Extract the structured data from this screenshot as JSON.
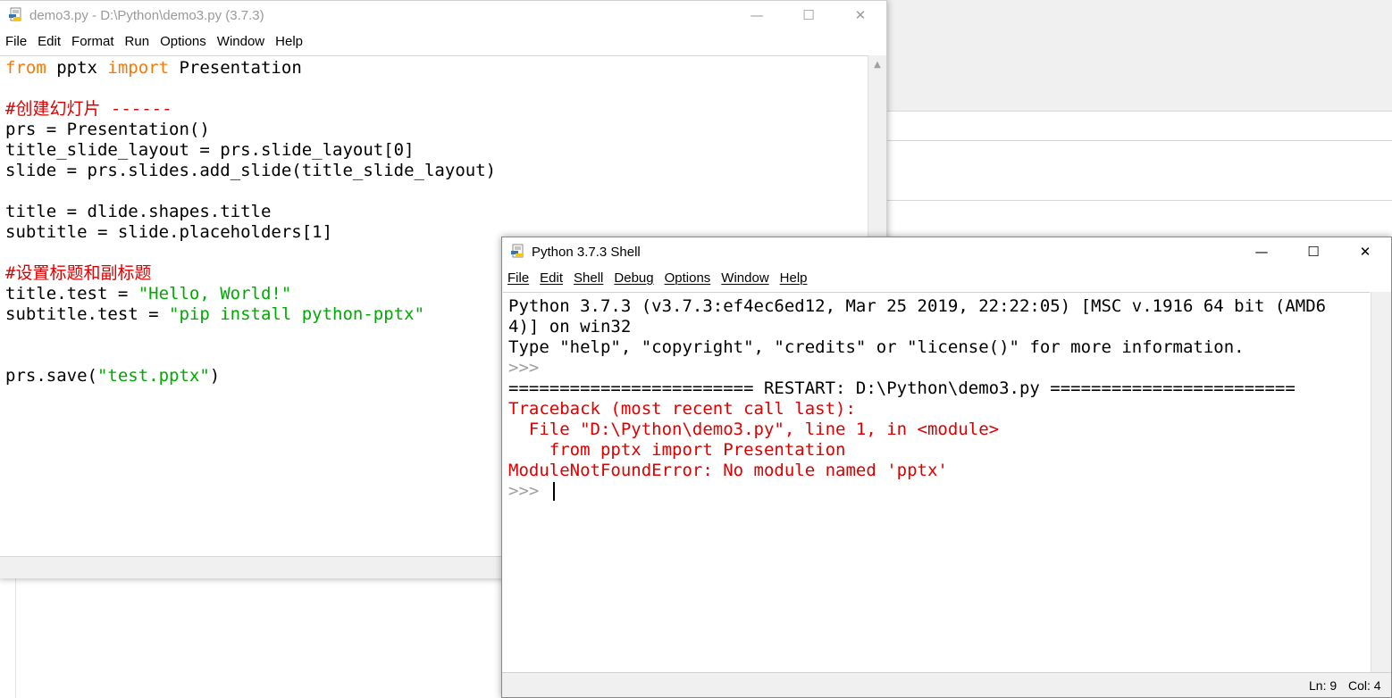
{
  "editor": {
    "title": "demo3.py - D:\\Python\\demo3.py (3.7.3)",
    "menu": [
      "File",
      "Edit",
      "Format",
      "Run",
      "Options",
      "Window",
      "Help"
    ],
    "controls": {
      "minimize": "—",
      "maximize": "☐",
      "close": "✕"
    },
    "code": [
      [
        {
          "t": "from",
          "c": "kw"
        },
        {
          "t": " pptx ",
          "c": ""
        },
        {
          "t": "import",
          "c": "kw"
        },
        {
          "t": " Presentation",
          "c": ""
        }
      ],
      [],
      [
        {
          "t": "#创建幻灯片 ------",
          "c": "cm"
        }
      ],
      [
        {
          "t": "prs = Presentation()",
          "c": ""
        }
      ],
      [
        {
          "t": "title_slide_layout = prs.slide_layout[0]",
          "c": ""
        }
      ],
      [
        {
          "t": "slide = prs.slides.add_slide(title_slide_layout)",
          "c": ""
        }
      ],
      [],
      [
        {
          "t": "title = dlide.shapes.title",
          "c": ""
        }
      ],
      [
        {
          "t": "subtitle = slide.placeholders[1]",
          "c": ""
        }
      ],
      [],
      [
        {
          "t": "#设置标题和副标题",
          "c": "cm"
        }
      ],
      [
        {
          "t": "title.test = ",
          "c": ""
        },
        {
          "t": "\"Hello, World!\"",
          "c": "str"
        }
      ],
      [
        {
          "t": "subtitle.test = ",
          "c": ""
        },
        {
          "t": "\"pip install python-pptx\"",
          "c": "str"
        }
      ],
      [],
      [],
      [
        {
          "t": "prs.save(",
          "c": ""
        },
        {
          "t": "\"test.pptx\"",
          "c": "str"
        },
        {
          "t": ")",
          "c": ""
        }
      ]
    ]
  },
  "shell": {
    "title": "Python 3.7.3 Shell",
    "menu": [
      "File",
      "Edit",
      "Shell",
      "Debug",
      "Options",
      "Window",
      "Help"
    ],
    "controls": {
      "minimize": "—",
      "maximize": "☐",
      "close": "✕"
    },
    "lines": [
      [
        {
          "t": "Python 3.7.3 (v3.7.3:ef4ec6ed12, Mar 25 2019, 22:22:05) [MSC v.1916 64 bit (AMD6",
          "c": ""
        }
      ],
      [
        {
          "t": "4)] on win32",
          "c": ""
        }
      ],
      [
        {
          "t": "Type \"help\", \"copyright\", \"credits\" or \"license()\" for more information.",
          "c": ""
        }
      ],
      [
        {
          "t": ">>> ",
          "c": "prompt"
        }
      ],
      [
        {
          "t": "======================== RESTART: D:\\Python\\demo3.py ========================",
          "c": ""
        }
      ],
      [
        {
          "t": "Traceback (most recent call last):",
          "c": "err"
        }
      ],
      [
        {
          "t": "  File \"D:\\Python\\demo3.py\", line 1, in <module>",
          "c": "err"
        }
      ],
      [
        {
          "t": "    from pptx import Presentation",
          "c": "err"
        }
      ],
      [
        {
          "t": "ModuleNotFoundError: No module named 'pptx'",
          "c": "err"
        }
      ],
      [
        {
          "t": ">>> ",
          "c": "prompt"
        }
      ]
    ],
    "status": {
      "line": "Ln: 9",
      "col": "Col: 4"
    }
  },
  "colors": {
    "keyword": "#ff7700",
    "comment": "#dd0000",
    "string": "#00aa00",
    "error": "#dd0000",
    "prompt": "#a0a0a0"
  }
}
